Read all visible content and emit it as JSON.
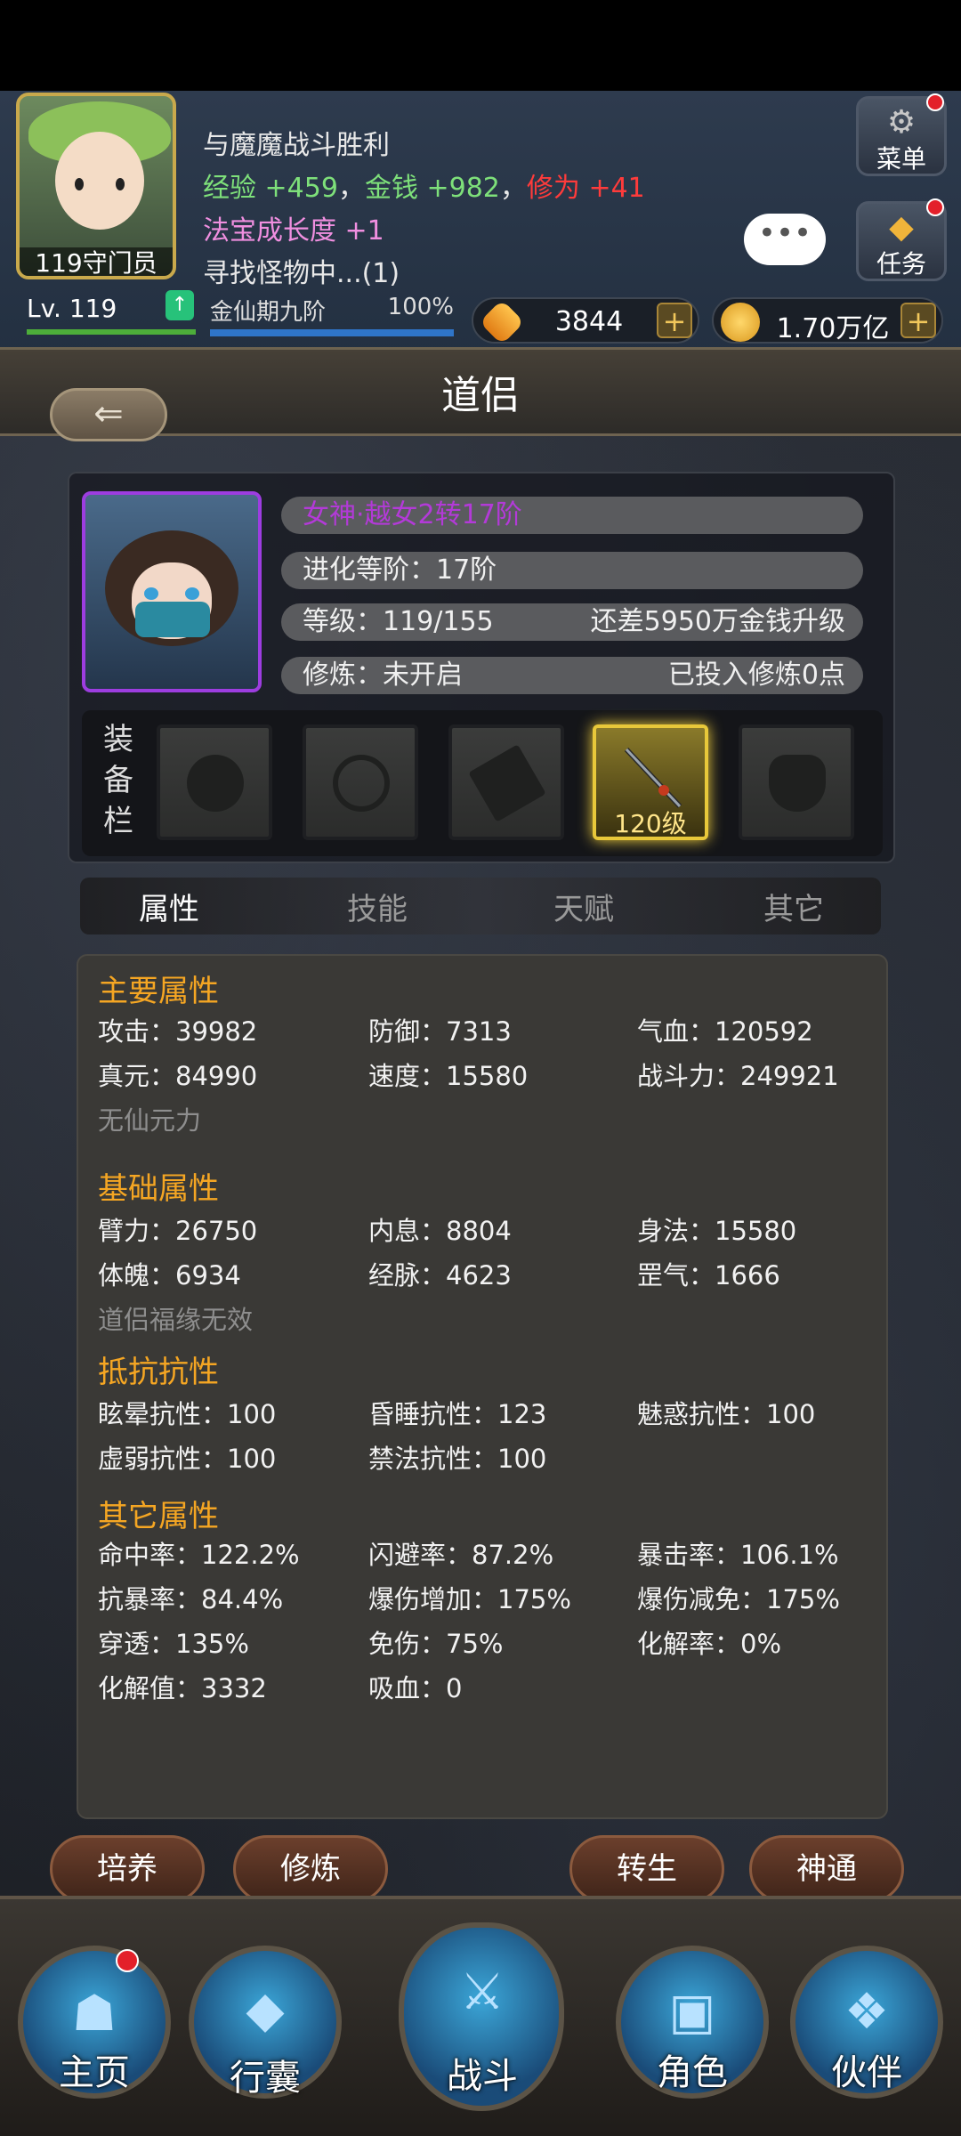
{
  "header": {
    "avatar_label": "119守门员",
    "log": {
      "line1": "与魔魔战斗胜利",
      "exp_label": "经验",
      "exp_value": "+459",
      "sep1": "，",
      "gold_label": "金钱",
      "gold_value": "+982",
      "sep2": "，",
      "cult_label": "修为",
      "cult_value": "+41",
      "treasure_label": "法宝成长度",
      "treasure_value": "+1",
      "line4": "寻找怪物中...(1)"
    },
    "chat_icon": "•••",
    "menu_label": "菜单",
    "task_label": "任务"
  },
  "stats": {
    "level": "119",
    "level_prefix": "Lv.",
    "realm": "金仙期九阶",
    "realm_percent": "100%",
    "gems": "3844",
    "gold": "1.70万亿",
    "plus_label": "+"
  },
  "page": {
    "title": "道侣",
    "back_icon": "⇐"
  },
  "companion": {
    "name": "女神·越女2转17阶",
    "evo": "进化等阶：17阶",
    "level": "等级：119/155",
    "level_right": "还差5950万金钱升级",
    "train": "修炼：未开启",
    "train_right": "已投入修炼0点"
  },
  "equipment": {
    "label_1": "装",
    "label_2": "备",
    "label_3": "栏",
    "weapon_level": "120级"
  },
  "tabs": {
    "attributes": "属性",
    "skills": "技能",
    "talent": "天赋",
    "other": "其它"
  },
  "attributes": {
    "main_title": "主要属性",
    "attack": "攻击：39982",
    "defense": "防御：7313",
    "hp": "气血：120592",
    "true_yuan": "真元：84990",
    "speed": "速度：15580",
    "power": "战斗力：249921",
    "main_note": "无仙元力",
    "basic_title": "基础属性",
    "arm": "臂力：26750",
    "inner": "内息：8804",
    "agility": "身法：15580",
    "body": "体魄：6934",
    "meridian": "经脉：4623",
    "aura": "罡气：1666",
    "basic_note": "道侣福缘无效",
    "resist_title": "抵抗抗性",
    "stun": "眩晕抗性：100",
    "sleep": "昏睡抗性：123",
    "charm": "魅惑抗性：100",
    "weak": "虚弱抗性：100",
    "silence": "禁法抗性：100",
    "other_title": "其它属性",
    "hit": "命中率：122.2%",
    "dodge": "闪避率：87.2%",
    "crit": "暴击率：106.1%",
    "anti_crit": "抗暴率：84.4%",
    "crit_dmg": "爆伤增加：175%",
    "crit_red": "爆伤减免：175%",
    "pierce": "穿透：135%",
    "dmg_red": "免伤：75%",
    "resolve_rate": "化解率：0%",
    "resolve_val": "化解值：3332",
    "lifesteal": "吸血：0"
  },
  "actions": {
    "cultivate": "培养",
    "train": "修炼",
    "rebirth": "转生",
    "divine": "神通"
  },
  "nav": {
    "home": "主页",
    "bag": "行囊",
    "battle": "战斗",
    "role": "角色",
    "partner": "伙伴"
  },
  "colors": {
    "accent_gold": "#f5a623",
    "name_purple": "#b33ad8",
    "positive_green": "#7ee07a",
    "negative_red": "#ff3b3b"
  }
}
